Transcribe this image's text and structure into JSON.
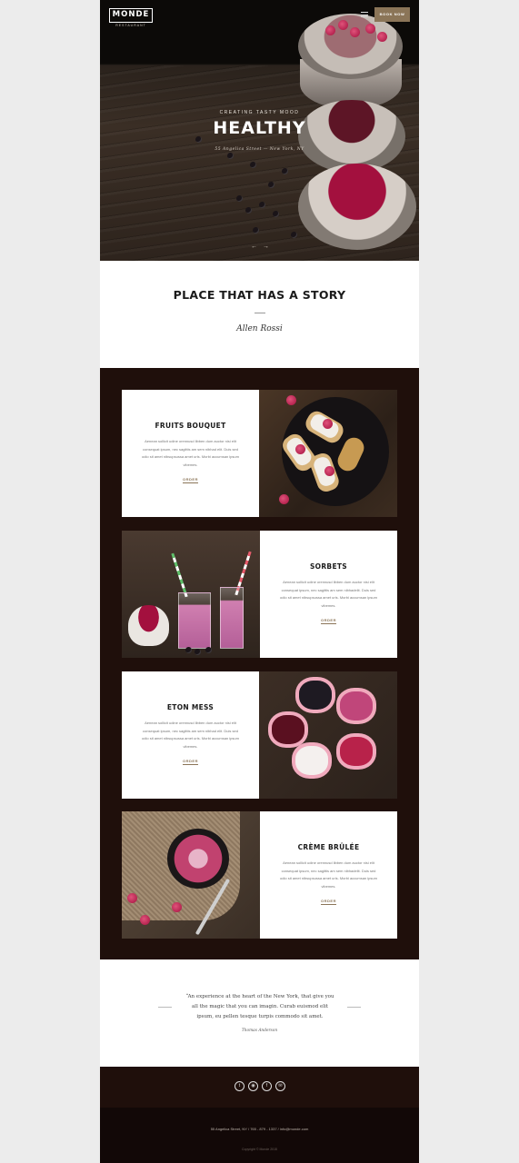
{
  "header": {
    "logo": "MONDE",
    "logo_subtitle": "RESTAURANT",
    "book_label": "BOOK NOW"
  },
  "hero": {
    "kicker": "CREATING TASTY MOOD",
    "title": "HEALTHY",
    "address": "55 Angelica Street — New York, NY"
  },
  "story": {
    "title": "PLACE THAT HAS A STORY",
    "signature": "Allen Rossi"
  },
  "menu": {
    "items": [
      {
        "title": "FRUITS BOUQUET",
        "description": "Aenean sollicit udine orennusd libben dum auctor nisi elit consequat ipsum, nec sagittis am sem nibhad elit. Duis sed odio sit amet nibsupsussa amet uris. Morbi accumsan ipsum vibemes.",
        "link": "ORDER"
      },
      {
        "title": "SORBETS",
        "description": "Aenean sollicit udine orennusd libben dum auctor nisi elit consequat ipsum, nec sagittis am sem nibhadelit. Duis sed odio sit amet nibsupsussa amet uris. Morbi accumsan ipsum vibemes.",
        "link": "ORDER"
      },
      {
        "title": "ETON MESS",
        "description": "Aenean sollicit udine orennusd libben dum auctor nisi elit consequat ipsum, nec sagittis am sem nibhad elit. Duis sed odio sit amet nibsupsussa amet uris. Morbi accumsan ipsum vibemes.",
        "link": "ORDER"
      },
      {
        "title": "CRÈME BRÛLÉE",
        "description": "Aenean sollicit udine orennusd libben dum auctor nisi elit consequat ipsum, nec sagittis am sem nibhadelit. Duis sed odio sit amet nibsupsussa amet uris. Morbi accumsan ipsum vibemes.",
        "link": "ORDER"
      }
    ]
  },
  "quote": {
    "text": "“An experience at the heart of the New York, that give you all the magic that you can imagin. Curab euismod elit ipsum, eu pellen tesque turpis commodo sit amet.",
    "author": "Thomas Anderson"
  },
  "social": {
    "icons": [
      "twitter-icon",
      "instagram-icon",
      "facebook-icon",
      "email-icon"
    ]
  },
  "footer": {
    "address": "55 Angelica Street, NY  /  765 - 879 - 1337  /  info@monde.com",
    "copyright": "Copyright © Monde 2015"
  },
  "colors": {
    "accent": "#8b7558",
    "dark_section": "#1f0f0b",
    "footer": "#120807"
  }
}
